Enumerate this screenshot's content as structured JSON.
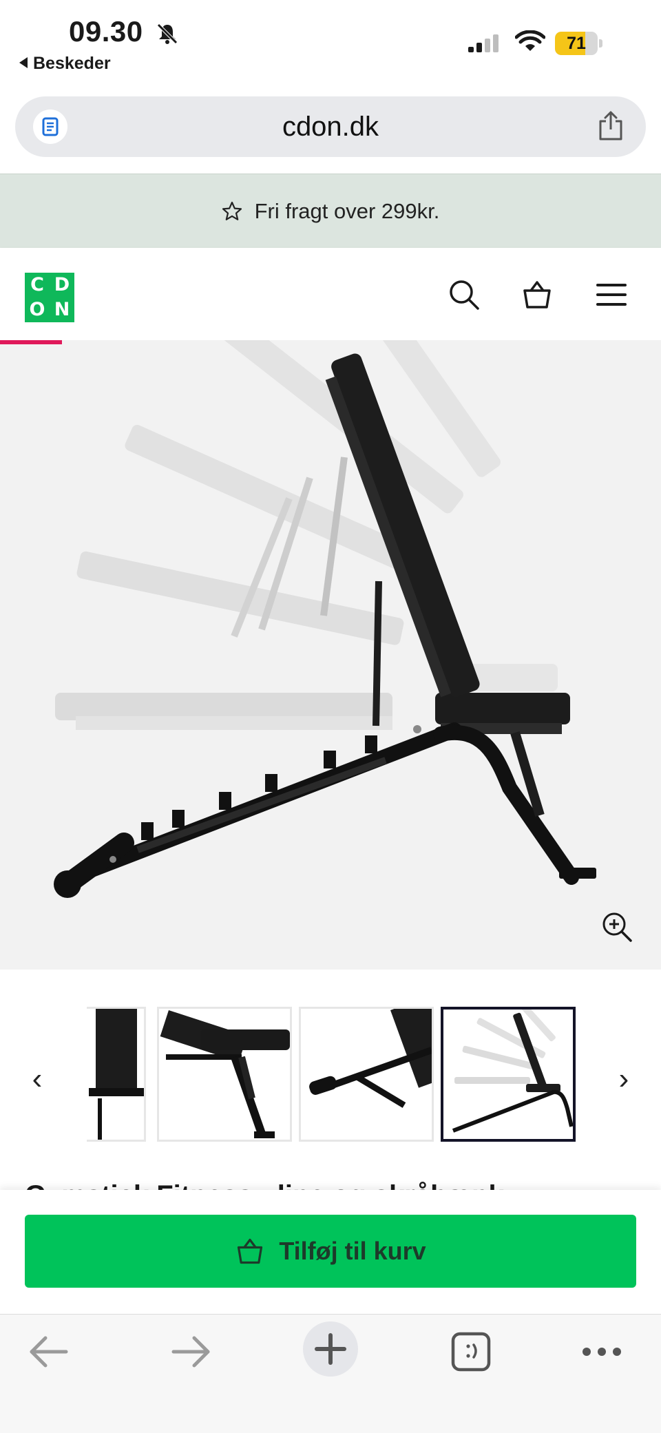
{
  "status_bar": {
    "time": "09.30",
    "back_app": "Beskeder",
    "battery_level": "71",
    "battery_fraction": 0.71,
    "silent_icon": "bell-slash-icon",
    "signal_icon": "cellular-signal-icon",
    "wifi_icon": "wifi-icon"
  },
  "url_bar": {
    "domain": "cdon.dk",
    "reader_icon": "page-icon",
    "share_icon": "share-icon"
  },
  "banner": {
    "text": "Fri fragt over 299kr.",
    "icon": "star-outline-icon"
  },
  "header": {
    "logo_letters": [
      "C",
      "D",
      "O",
      "N"
    ],
    "search_icon": "search-icon",
    "cart_icon": "basket-icon",
    "menu_icon": "hamburger-menu-icon",
    "brand_color": "#0fb85a",
    "accent_color": "#e0195a"
  },
  "gallery": {
    "main_image": "adjustable-weight-bench-motion-composite",
    "zoom_icon": "zoom-in-icon",
    "prev_arrow": "‹",
    "next_arrow": "›",
    "thumbnails": [
      {
        "name": "bench-backrest-closeup"
      },
      {
        "name": "bench-seat-and-legs"
      },
      {
        "name": "bench-foot-bar"
      },
      {
        "name": "bench-motion-composite",
        "selected": true
      }
    ]
  },
  "product": {
    "title_partial": "Gymstick Fitness-, line og skråbænk"
  },
  "cart": {
    "button_label": "Tilføj til kurv",
    "button_color": "#00c35a"
  },
  "browser_toolbar": {
    "back_icon": "arrow-left-icon",
    "forward_icon": "arrow-right-icon",
    "new_tab_icon": "plus-icon",
    "tabs_icon": "tabs-icon",
    "more_icon": "more-dots-icon"
  }
}
